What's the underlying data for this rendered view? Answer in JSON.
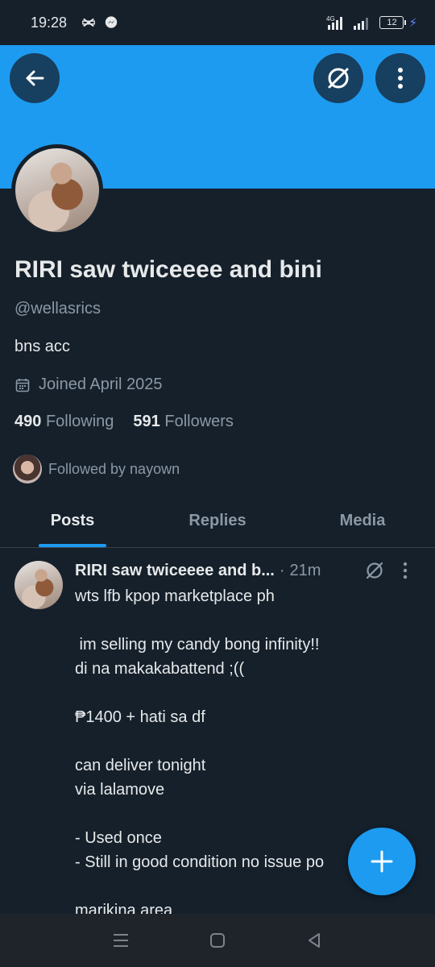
{
  "status_bar": {
    "time": "19:28",
    "network": "4G",
    "battery": "12",
    "icons": [
      "capcut-icon",
      "messenger-icon",
      "signal-icon",
      "wifi-icon",
      "battery-icon",
      "charging-icon"
    ]
  },
  "profile": {
    "display_name": "RIRI saw twiceeee and bini",
    "handle": "@wellasrics",
    "bio": "bns acc",
    "joined": "Joined April 2025",
    "following_count": "490",
    "following_label": "Following",
    "followers_count": "591",
    "followers_label": "Followers",
    "followed_by": "Followed by nayown"
  },
  "tabs": [
    {
      "label": "Posts",
      "active": true
    },
    {
      "label": "Replies",
      "active": false
    },
    {
      "label": "Media",
      "active": false
    }
  ],
  "post": {
    "author": "RIRI saw twiceeee and b...",
    "separator": "·",
    "time": "21m",
    "text": "wts lfb kpop marketplace ph\n\n im selling my candy bong infinity!!\ndi na makakabattend ;((\n\n₱1400 + hati sa df\n\ncan deliver tonight\nvia lalamove\n\n- Used once\n- Still in good condition no issue po\n\nmarikina area"
  },
  "colors": {
    "background": "#15202b",
    "banner": "#1d9bf0",
    "accent": "#1d9bf0",
    "secondary_text": "#8b98a5",
    "primary_text": "#e7e9ea"
  }
}
